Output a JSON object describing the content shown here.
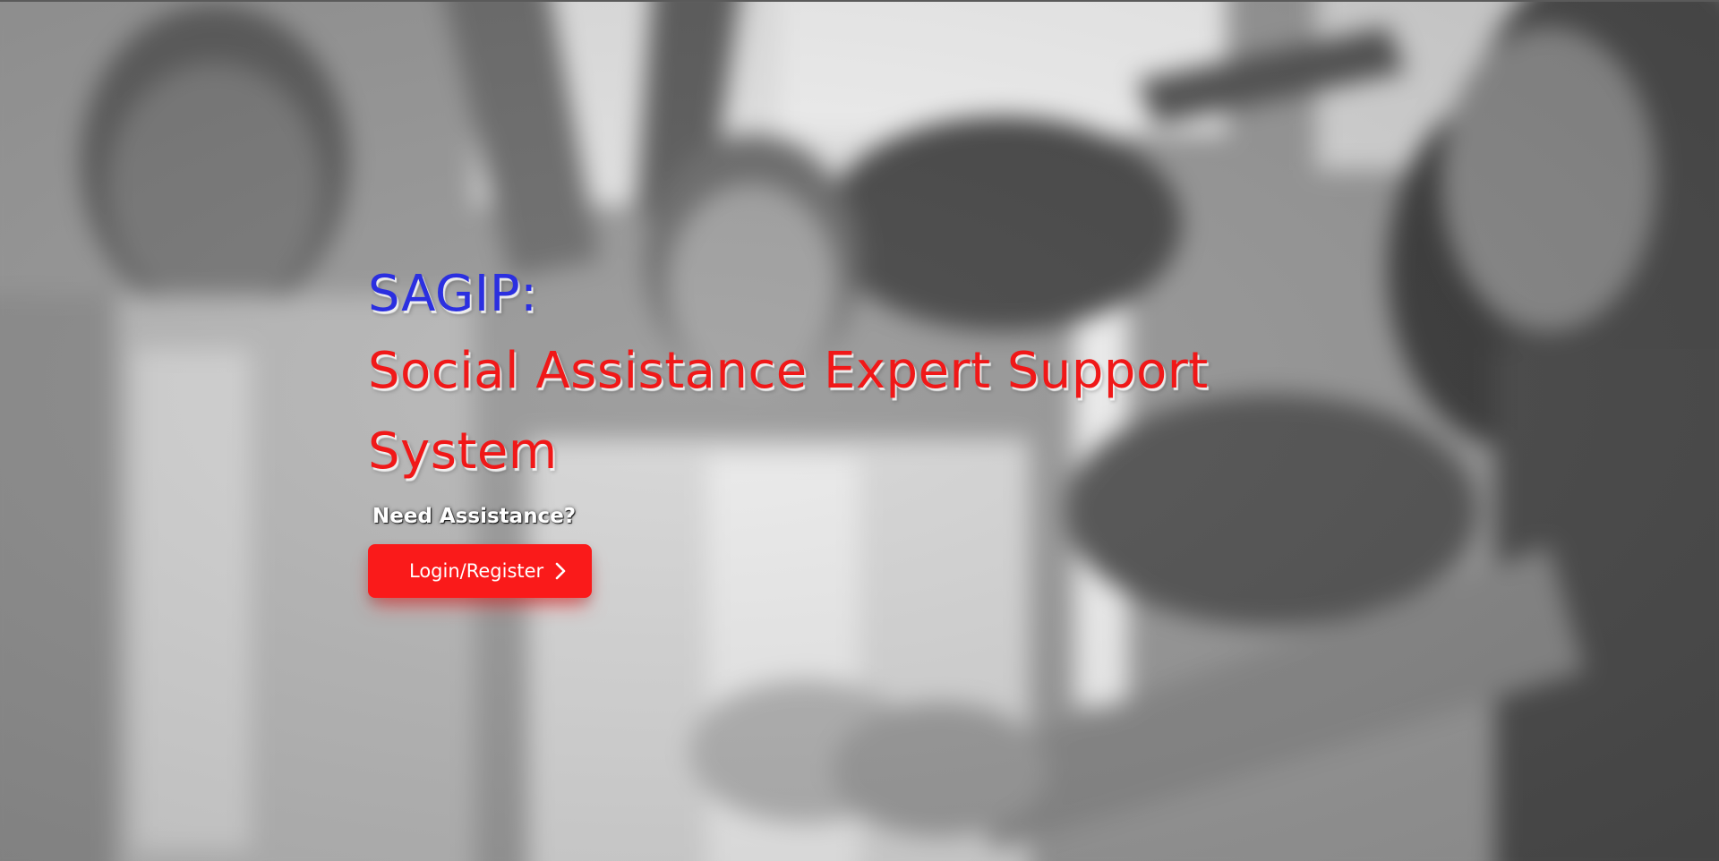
{
  "hero": {
    "brand": "SAGIP:",
    "headline_line1": "Social Assistance Expert Support",
    "headline_line2": "System",
    "prompt": "Need Assistance?",
    "cta_label": "Login/Register"
  },
  "icons": {
    "cta_icon": "chevron-right-icon"
  },
  "colors": {
    "brand": "#2b2fe0",
    "headline": "#f01818",
    "cta_bg": "#fa1a1a",
    "cta_text": "#ffffff"
  }
}
